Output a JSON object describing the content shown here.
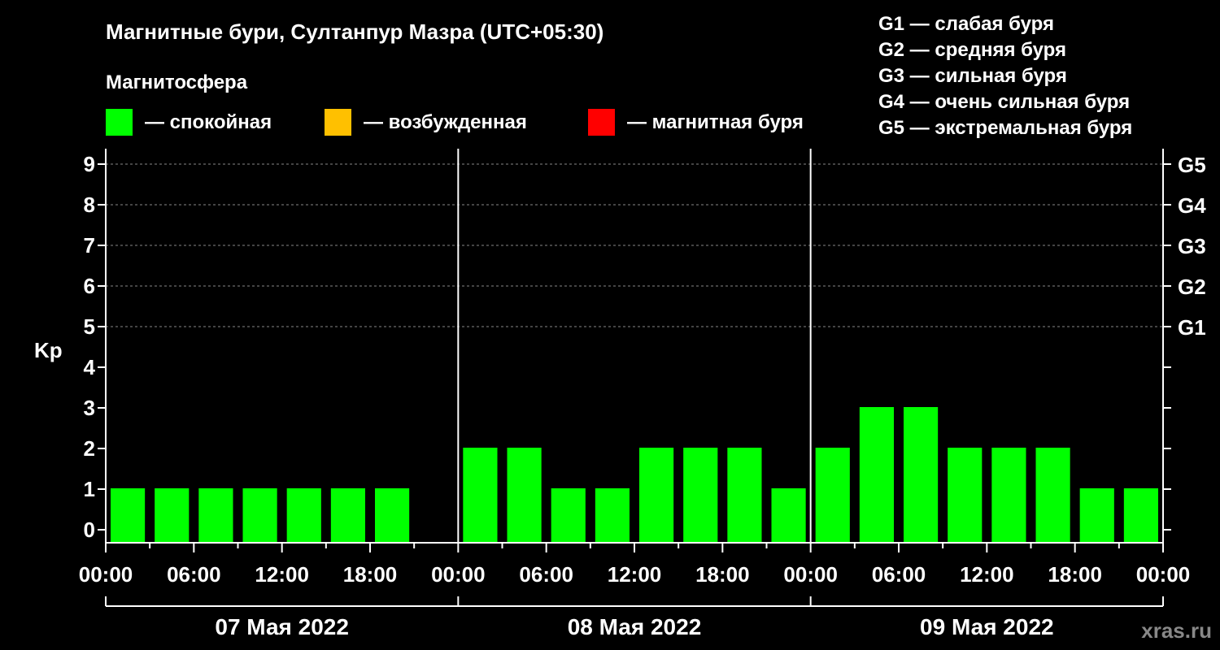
{
  "title": "Магнитные бури, Султанпур Мазра (UTC+05:30)",
  "legend": {
    "heading": "Магнитосфера",
    "items": [
      {
        "label": "— спокойная",
        "color": "#00ff00"
      },
      {
        "label": "— возбужденная",
        "color": "#ffc000"
      },
      {
        "label": "— магнитная буря",
        "color": "#ff0000"
      }
    ]
  },
  "g_legend": [
    "G1 — слабая буря",
    "G2 — средняя буря",
    "G3 — сильная буря",
    "G4 — очень сильная буря",
    "G5 — экстремальная буря"
  ],
  "watermark": "xras.ru",
  "chart_data": {
    "type": "bar",
    "ylabel": "Kp",
    "ylim": [
      0,
      9
    ],
    "yticks": [
      0,
      1,
      2,
      3,
      4,
      5,
      6,
      7,
      8,
      9
    ],
    "g_levels": [
      {
        "label": "G1",
        "kp": 5
      },
      {
        "label": "G2",
        "kp": 6
      },
      {
        "label": "G3",
        "kp": 7
      },
      {
        "label": "G4",
        "kp": 8
      },
      {
        "label": "G5",
        "kp": 9
      }
    ],
    "grid": "dashed horizontal at G levels",
    "xticks": [
      "00:00",
      "06:00",
      "12:00",
      "18:00",
      "00:00",
      "06:00",
      "12:00",
      "18:00",
      "00:00",
      "06:00",
      "12:00",
      "18:00",
      "00:00"
    ],
    "days": [
      "07 Мая 2022",
      "08 Мая 2022",
      "09 Мая 2022"
    ],
    "interval_hours": 3,
    "series": [
      {
        "values": [
          1,
          1,
          1,
          1,
          1,
          1,
          1,
          null,
          2,
          2,
          1,
          1,
          2,
          2,
          2,
          1,
          2,
          3,
          3,
          2,
          2,
          2,
          1,
          1
        ],
        "color": "#00ff00"
      }
    ]
  }
}
